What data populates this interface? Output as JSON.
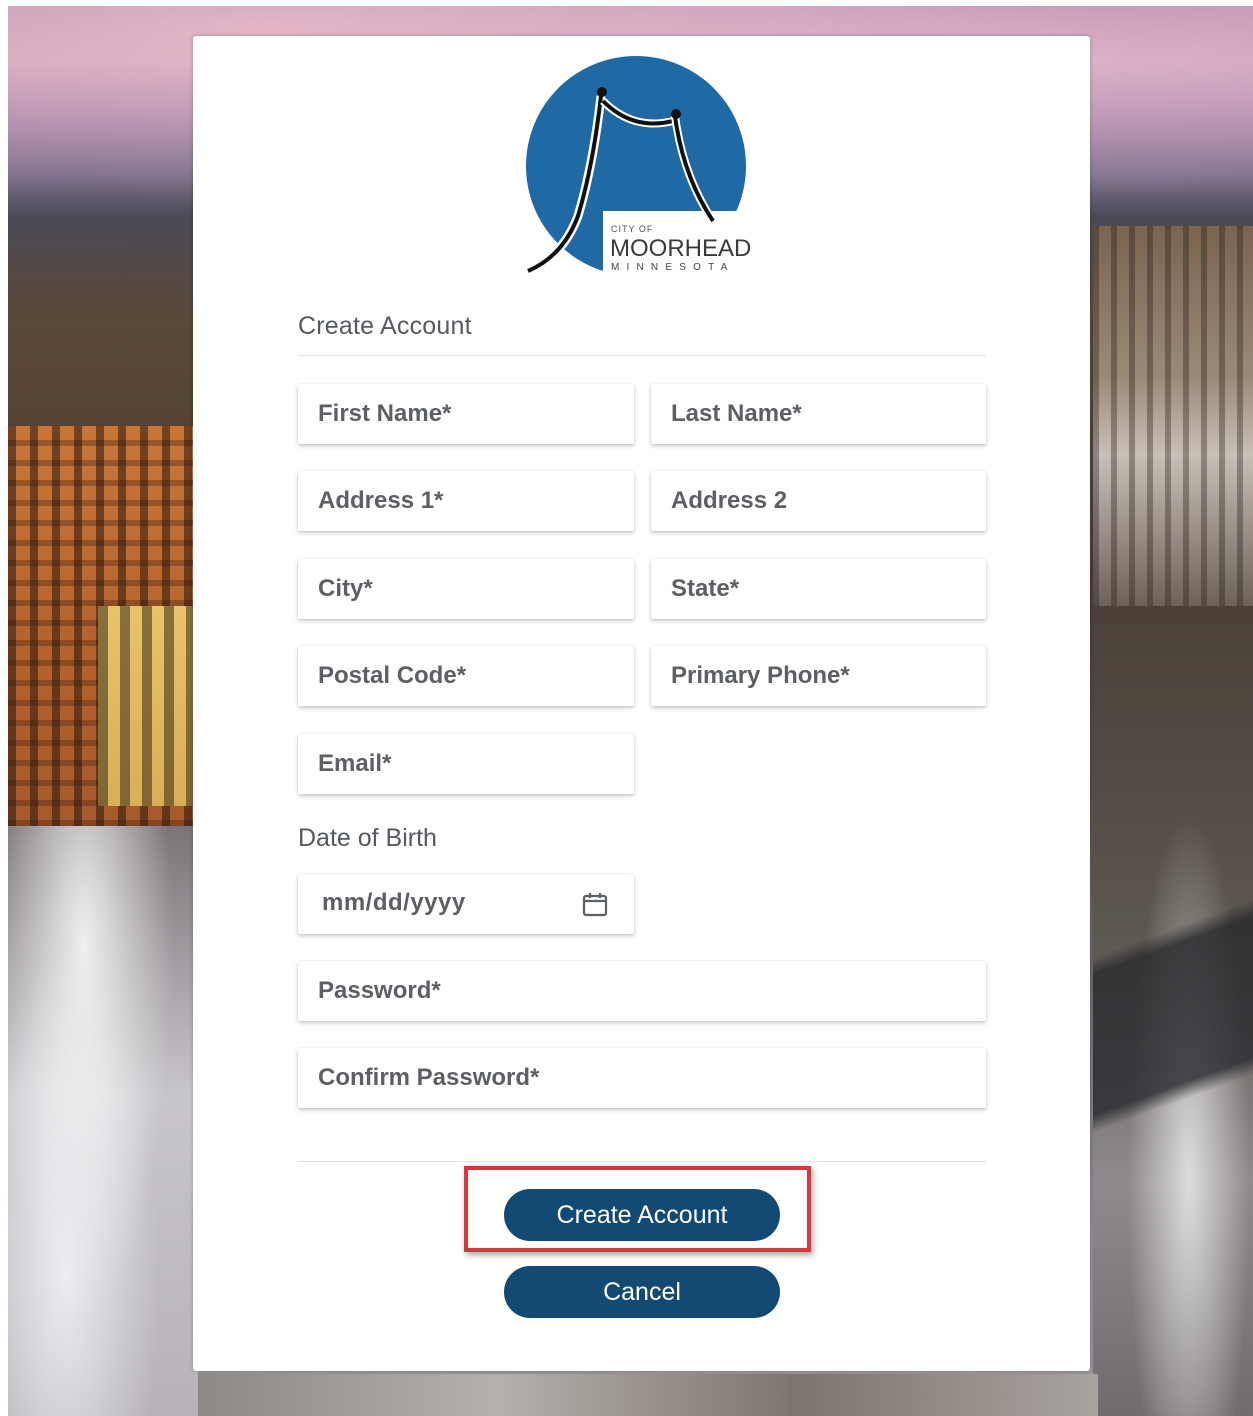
{
  "logo": {
    "small_text": "CITY OF",
    "name": "MOORHEAD",
    "state": "MINNESOTA",
    "circle_color": "#1f6aa5"
  },
  "form": {
    "title": "Create Account",
    "fields": {
      "first_name": "First Name*",
      "last_name": "Last Name*",
      "address1": "Address 1*",
      "address2": "Address 2",
      "city": "City*",
      "state": "State*",
      "postal_code": "Postal Code*",
      "primary_phone": "Primary Phone*",
      "email": "Email*",
      "password": "Password*",
      "confirm_password": "Confirm Password*"
    },
    "dob": {
      "label": "Date of Birth",
      "placeholder": "mm/dd/yyyy",
      "icon": "calendar-icon"
    }
  },
  "buttons": {
    "create": "Create Account",
    "cancel": "Cancel"
  },
  "colors": {
    "button": "#134a74",
    "highlight": "#e0343c",
    "label": "#555a60"
  }
}
